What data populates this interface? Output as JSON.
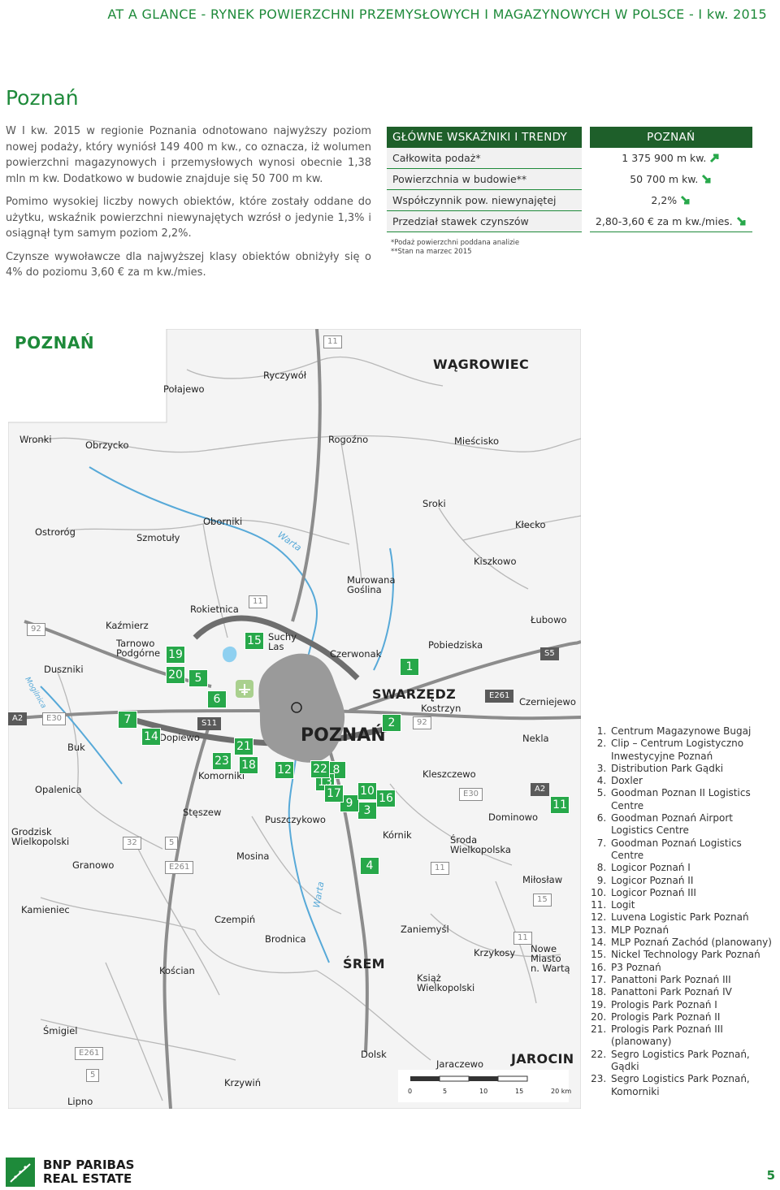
{
  "header": {
    "title": "AT A GLANCE - RYNEK POWIERZCHNI PRZEMYSŁOWYCH I MAGAZYNOWYCH W POLSCE - I kw. 2015"
  },
  "page_title": "Poznań",
  "intro": {
    "p1": "W I kw. 2015 w regionie Poznania odnotowano najwyższy poziom nowej podaży, który wyniósł 149 400 m kw., co oznacza, iż wolumen powierzchni magazynowych i przemysłowych wynosi obecnie 1,38 mln m kw. Dodatkowo w budowie znajduje się 50 700 m kw.",
    "p2": "Pomimo wysokiej liczby nowych obiektów, które zostały oddane do użytku, wskaźnik powierzchni niewynajętych wzrósł o jedynie 1,3% i osiągnął tym samym poziom 2,2%.",
    "p3": "Czynsze wywoławcze dla najwyższej klasy obiektów obniżyły się o 4% do poziomu 3,60 € za m kw./mies."
  },
  "kpi": {
    "header_left": "GŁÓWNE WSKAŹNIKI I TRENDY",
    "header_right": "POZNAŃ",
    "rows": [
      {
        "label": "Całkowita podaż*",
        "value": "1 375 900 m kw.",
        "trend": "up"
      },
      {
        "label": "Powierzchnia w budowie**",
        "value": "50 700 m kw.",
        "trend": "down"
      },
      {
        "label": "Współczynnik pow. niewynajętej",
        "value": "2,2%",
        "trend": "down"
      },
      {
        "label": "Przedział stawek czynszów",
        "value": "2,80-3,60 € za m kw./mies.",
        "trend": "down"
      }
    ],
    "note1": "*Podaż powierzchni poddana analizie",
    "note2": "**Stan na marzec 2015"
  },
  "map": {
    "title": "POZNAŃ",
    "towns": [
      "Połajewo",
      "Ryczywół",
      "WĄGROWIEC",
      "Wronki",
      "Obrzycko",
      "Rogoźno",
      "Mieścisko",
      "Sroki",
      "Ostroróg",
      "Szmotuły",
      "Oborniki",
      "Kłecko",
      "Kiszkowo",
      "Murowana Goślina",
      "Rokietnica",
      "Łubowo",
      "Kaźmierz",
      "Suchy Las",
      "Tarnowo Podgórne",
      "Pobiedziska",
      "Duszniki",
      "Czerwonak",
      "SWARZĘDZ",
      "Czerniejewo",
      "Kostrzyn",
      "Buk",
      "Dopiewo",
      "POZNAŃ",
      "Nekla",
      "Komorniki",
      "Kleszczewo",
      "Opalenica",
      "Stęszew",
      "Dominowo",
      "Puszczykowo",
      "Grodzisk Wielkopolski",
      "Kórnik",
      "Środa Wielkopolska",
      "Granowo",
      "Mosina",
      "Miłosław",
      "Kamieniec",
      "Czempiń",
      "Zaniemyśl",
      "Brodnica",
      "Krzykosy",
      "Nowe Miasto n. Wartą",
      "Kościan",
      "ŚREM",
      "Książ Wielkopolski",
      "Śmigiel",
      "Dolsk",
      "Jaraczewo",
      "JAROCIN",
      "Krzywiń",
      "Lipno"
    ],
    "rivers": [
      "Warta",
      "Warta",
      "Mogilnica"
    ],
    "roads": [
      "11",
      "11",
      "92",
      "S5",
      "A2",
      "E30",
      "S11",
      "E261",
      "2",
      "92",
      "E30",
      "A2",
      "11",
      "32",
      "5",
      "E261",
      "11",
      "15",
      "11",
      "E261",
      "5"
    ],
    "markers": [
      "1",
      "2",
      "3",
      "4",
      "5",
      "6",
      "7",
      "8",
      "9",
      "10",
      "11",
      "12",
      "13",
      "14",
      "15",
      "16",
      "17",
      "18",
      "19",
      "20",
      "21",
      "22",
      "23"
    ],
    "scale": [
      "0",
      "5",
      "10",
      "15",
      "20 km"
    ]
  },
  "legend": [
    "Centrum Magazynowe Bugaj",
    "Clip – Centrum Logistyczno Inwestycyjne Poznań",
    "Distribution Park Gądki",
    "Doxler",
    "Goodman Poznan II Logistics Centre",
    "Goodman Poznań Airport Logistics Centre",
    "Goodman Poznań Logistics Centre",
    "Logicor Poznań I",
    "Logicor Poznań II",
    "Logicor Poznań III",
    "Logit",
    "Luvena Logistic Park Poznań",
    "MLP Poznań",
    "MLP Poznań Zachód (planowany)",
    "Nickel Technology Park Poznań",
    "P3 Poznań",
    "Panattoni Park Poznań III",
    "Panattoni Park Poznań IV",
    "Prologis Park Poznań I",
    "Prologis Park Poznań II",
    "Prologis Park Poznań III (planowany)",
    "Segro Logistics Park Poznań, Gądki",
    "Segro Logistics Park Poznań, Komorniki"
  ],
  "footer": {
    "logo_line1": "BNP PARIBAS",
    "logo_line2": "REAL ESTATE",
    "page_number": "5"
  },
  "colors": {
    "accent": "#1e8a3a",
    "header_dark": "#1e5f2a",
    "marker": "#27a84a",
    "river": "#57a9d8",
    "city": "#9a9a9a"
  }
}
